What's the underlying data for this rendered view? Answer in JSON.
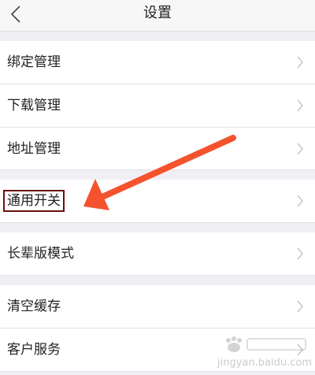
{
  "header": {
    "title": "设置",
    "back_icon": "back-chevron-icon"
  },
  "menu": {
    "items": [
      {
        "label": "绑定管理"
      },
      {
        "label": "下载管理"
      },
      {
        "label": "地址管理"
      },
      {
        "label": "通用开关",
        "highlighted": true
      },
      {
        "label": "长辈版模式"
      },
      {
        "label": "清空缓存"
      },
      {
        "label": "客户服务"
      }
    ],
    "chevron_icon": "chevron-right-icon"
  },
  "annotation": {
    "arrow_color": "#f4532e",
    "box_color": "#6b0f0f"
  },
  "watermark": {
    "logo": "baidu-jingyan-logo",
    "url": "jingyan.baidu.com"
  },
  "colors": {
    "background": "#efeff4",
    "row": "#ffffff",
    "text": "#222222",
    "chevron": "#c7c7cc"
  }
}
